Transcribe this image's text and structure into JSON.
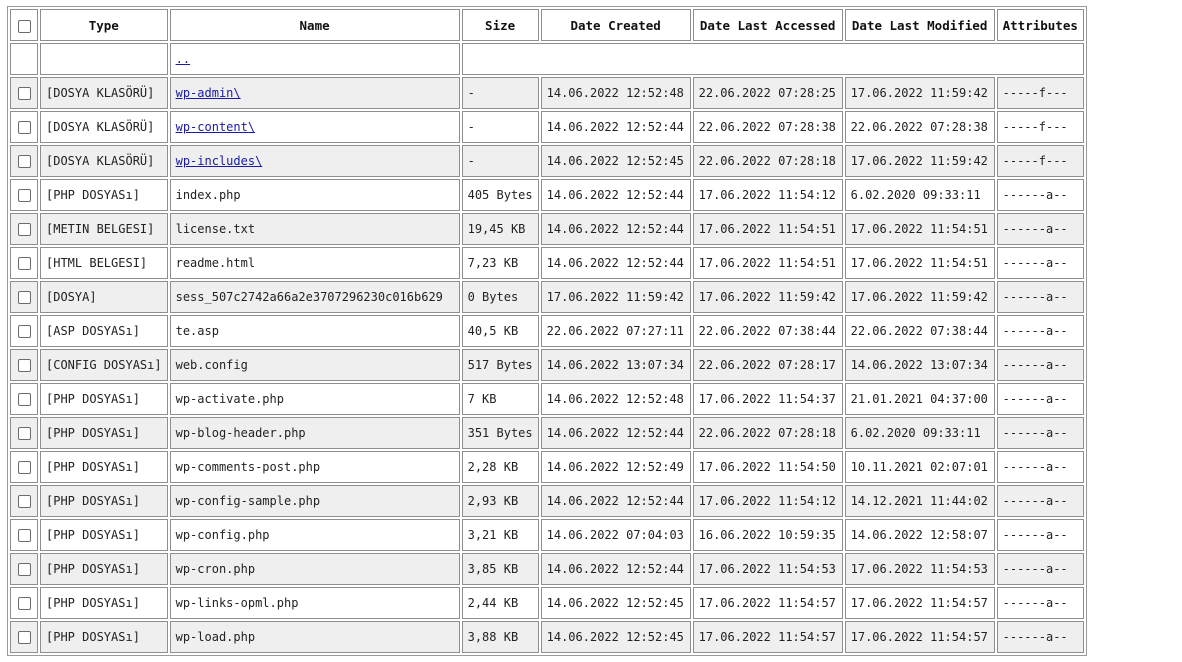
{
  "headers": {
    "type": "Type",
    "name": "Name",
    "size": "Size",
    "date_created": "Date Created",
    "date_accessed": "Date Last Accessed",
    "date_modified": "Date Last Modified",
    "attributes": "Attributes"
  },
  "parent_link": "..",
  "rows": [
    {
      "type": "[DOSYA KLASÖRÜ]",
      "name": "wp-admin\\",
      "link": true,
      "size": "-",
      "created": "14.06.2022 12:52:48",
      "accessed": "22.06.2022 07:28:25",
      "modified": "17.06.2022 11:59:42",
      "attrs": "-----f---"
    },
    {
      "type": "[DOSYA KLASÖRÜ]",
      "name": "wp-content\\",
      "link": true,
      "size": "-",
      "created": "14.06.2022 12:52:44",
      "accessed": "22.06.2022 07:28:38",
      "modified": "22.06.2022 07:28:38",
      "attrs": "-----f---"
    },
    {
      "type": "[DOSYA KLASÖRÜ]",
      "name": "wp-includes\\",
      "link": true,
      "size": "-",
      "created": "14.06.2022 12:52:45",
      "accessed": "22.06.2022 07:28:18",
      "modified": "17.06.2022 11:59:42",
      "attrs": "-----f---"
    },
    {
      "type": "[PHP DOSYASı]",
      "name": "index.php",
      "link": false,
      "size": "405 Bytes",
      "created": "14.06.2022 12:52:44",
      "accessed": "17.06.2022 11:54:12",
      "modified": "6.02.2020 09:33:11",
      "attrs": "------a--"
    },
    {
      "type": "[METIN BELGESI]",
      "name": "license.txt",
      "link": false,
      "size": "19,45 KB",
      "created": "14.06.2022 12:52:44",
      "accessed": "17.06.2022 11:54:51",
      "modified": "17.06.2022 11:54:51",
      "attrs": "------a--"
    },
    {
      "type": "[HTML BELGESI]",
      "name": "readme.html",
      "link": false,
      "size": "7,23 KB",
      "created": "14.06.2022 12:52:44",
      "accessed": "17.06.2022 11:54:51",
      "modified": "17.06.2022 11:54:51",
      "attrs": "------a--"
    },
    {
      "type": "[DOSYA]",
      "name": "sess_507c2742a66a2e3707296230c016b629",
      "link": false,
      "size": "0 Bytes",
      "created": "17.06.2022 11:59:42",
      "accessed": "17.06.2022 11:59:42",
      "modified": "17.06.2022 11:59:42",
      "attrs": "------a--"
    },
    {
      "type": "[ASP DOSYASı]",
      "name": "te.asp",
      "link": false,
      "size": "40,5 KB",
      "created": "22.06.2022 07:27:11",
      "accessed": "22.06.2022 07:38:44",
      "modified": "22.06.2022 07:38:44",
      "attrs": "------a--"
    },
    {
      "type": "[CONFIG DOSYASı]",
      "name": "web.config",
      "link": false,
      "size": "517 Bytes",
      "created": "14.06.2022 13:07:34",
      "accessed": "22.06.2022 07:28:17",
      "modified": "14.06.2022 13:07:34",
      "attrs": "------a--"
    },
    {
      "type": "[PHP DOSYASı]",
      "name": "wp-activate.php",
      "link": false,
      "size": "7 KB",
      "created": "14.06.2022 12:52:48",
      "accessed": "17.06.2022 11:54:37",
      "modified": "21.01.2021 04:37:00",
      "attrs": "------a--"
    },
    {
      "type": "[PHP DOSYASı]",
      "name": "wp-blog-header.php",
      "link": false,
      "size": "351 Bytes",
      "created": "14.06.2022 12:52:44",
      "accessed": "22.06.2022 07:28:18",
      "modified": "6.02.2020 09:33:11",
      "attrs": "------a--"
    },
    {
      "type": "[PHP DOSYASı]",
      "name": "wp-comments-post.php",
      "link": false,
      "size": "2,28 KB",
      "created": "14.06.2022 12:52:49",
      "accessed": "17.06.2022 11:54:50",
      "modified": "10.11.2021 02:07:01",
      "attrs": "------a--"
    },
    {
      "type": "[PHP DOSYASı]",
      "name": "wp-config-sample.php",
      "link": false,
      "size": "2,93 KB",
      "created": "14.06.2022 12:52:44",
      "accessed": "17.06.2022 11:54:12",
      "modified": "14.12.2021 11:44:02",
      "attrs": "------a--"
    },
    {
      "type": "[PHP DOSYASı]",
      "name": "wp-config.php",
      "link": false,
      "size": "3,21 KB",
      "created": "14.06.2022 07:04:03",
      "accessed": "16.06.2022 10:59:35",
      "modified": "14.06.2022 12:58:07",
      "attrs": "------a--"
    },
    {
      "type": "[PHP DOSYASı]",
      "name": "wp-cron.php",
      "link": false,
      "size": "3,85 KB",
      "created": "14.06.2022 12:52:44",
      "accessed": "17.06.2022 11:54:53",
      "modified": "17.06.2022 11:54:53",
      "attrs": "------a--"
    },
    {
      "type": "[PHP DOSYASı]",
      "name": "wp-links-opml.php",
      "link": false,
      "size": "2,44 KB",
      "created": "14.06.2022 12:52:45",
      "accessed": "17.06.2022 11:54:57",
      "modified": "17.06.2022 11:54:57",
      "attrs": "------a--"
    },
    {
      "type": "[PHP DOSYASı]",
      "name": "wp-load.php",
      "link": false,
      "size": "3,88 KB",
      "created": "14.06.2022 12:52:45",
      "accessed": "17.06.2022 11:54:57",
      "modified": "17.06.2022 11:54:57",
      "attrs": "------a--"
    }
  ]
}
